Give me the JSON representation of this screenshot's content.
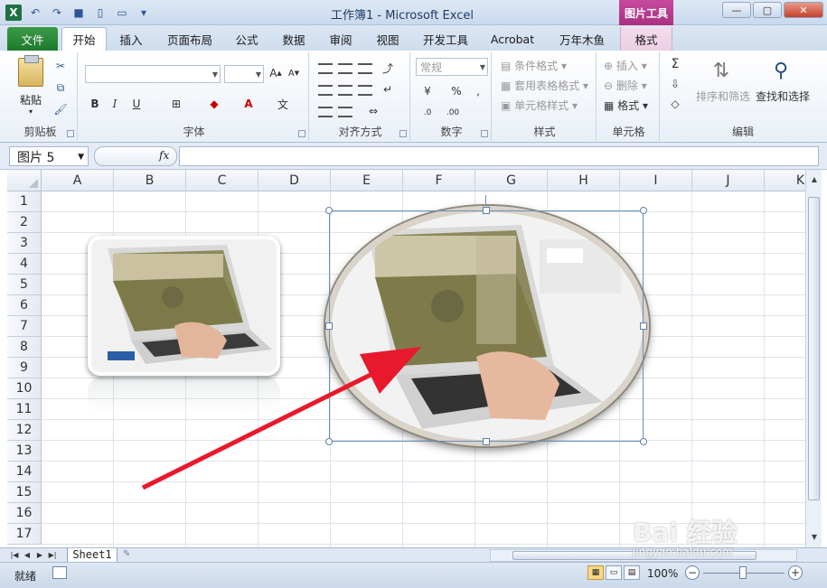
{
  "window": {
    "title": "工作簿1 - Microsoft Excel",
    "context_tab_group": "图片工具"
  },
  "qat": {
    "icons": [
      "excel-logo",
      "undo-icon",
      "redo-icon",
      "save-icon",
      "new-icon",
      "open-icon",
      "customize-icon"
    ]
  },
  "tabs": [
    {
      "label": "文件"
    },
    {
      "label": "开始"
    },
    {
      "label": "插入"
    },
    {
      "label": "页面布局"
    },
    {
      "label": "公式"
    },
    {
      "label": "数据"
    },
    {
      "label": "审阅"
    },
    {
      "label": "视图"
    },
    {
      "label": "开发工具"
    },
    {
      "label": "Acrobat"
    },
    {
      "label": "万年木鱼"
    },
    {
      "label": "格式"
    }
  ],
  "ribbon": {
    "clipboard": {
      "paste": "粘贴",
      "label": "剪贴板"
    },
    "font": {
      "label": "字体",
      "font_name": "",
      "font_size": ""
    },
    "alignment": {
      "label": "对齐方式"
    },
    "number": {
      "label": "数字",
      "format": "常规",
      "percent": "%"
    },
    "styles": {
      "label": "样式",
      "conditional": "条件格式",
      "table": "套用表格格式",
      "cell": "单元格样式"
    },
    "cells": {
      "label": "单元格",
      "insert": "插入",
      "delete": "删除",
      "format": "格式"
    },
    "editing": {
      "label": "编辑",
      "sort": "排序和筛选",
      "find": "查找和选择",
      "sigma": "Σ"
    }
  },
  "formula_bar": {
    "name_box": "图片 5",
    "fx": "fx",
    "value": ""
  },
  "grid": {
    "columns": [
      "A",
      "B",
      "C",
      "D",
      "E",
      "F",
      "G",
      "H",
      "I",
      "J",
      "K"
    ],
    "rows": [
      "1",
      "2",
      "3",
      "4",
      "5",
      "6",
      "7",
      "8",
      "9",
      "10",
      "11",
      "12",
      "13",
      "14",
      "15",
      "16",
      "17"
    ]
  },
  "sheets": {
    "active": "Sheet1"
  },
  "status": {
    "ready": "就绪",
    "zoom": "100%"
  },
  "watermark": {
    "main": "Bai 经验",
    "sub": "jingyan.baidu.com"
  },
  "colors": {
    "accent": "#1d7a2c",
    "arrow": "#e8192c",
    "selection": "#6a8fba"
  }
}
